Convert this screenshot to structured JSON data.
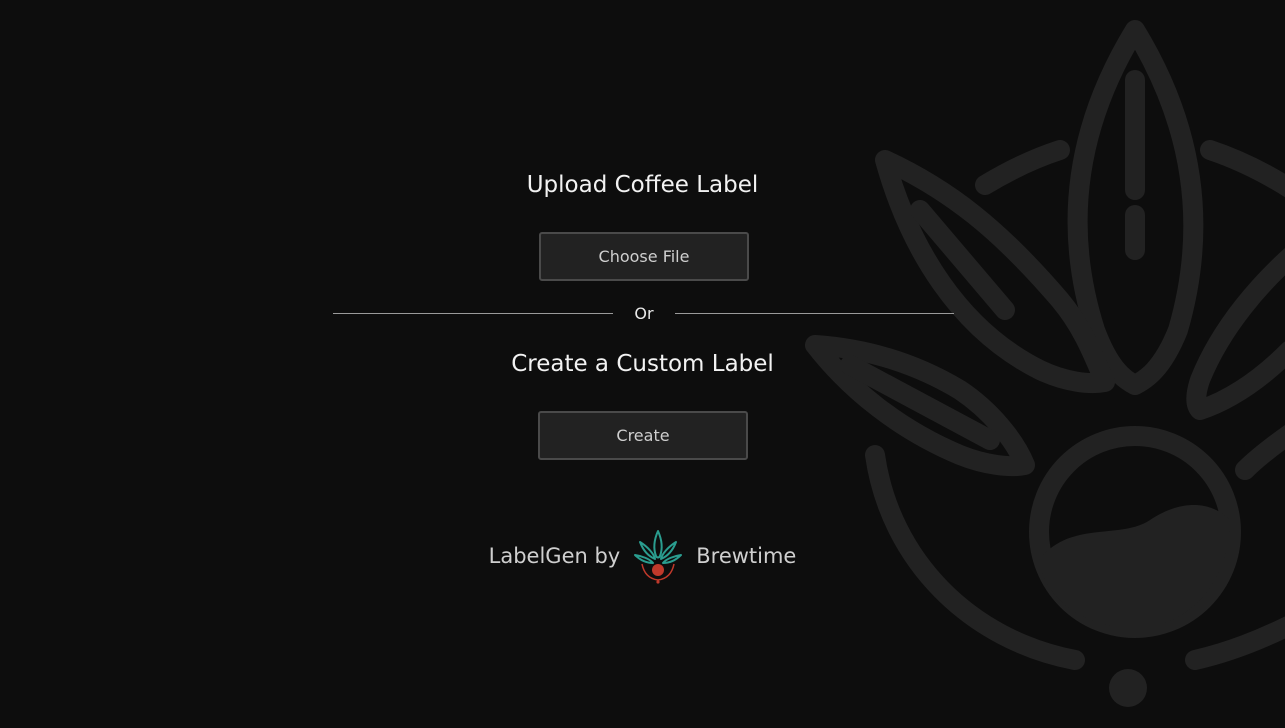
{
  "upload": {
    "title": "Upload Coffee Label",
    "choose_file_label": "Choose File"
  },
  "divider": {
    "text": "Or"
  },
  "custom": {
    "title": "Create a Custom Label",
    "create_label": "Create"
  },
  "footer": {
    "prefix": "LabelGen by",
    "brand": "Brewtime",
    "logo_icon": "brewtime-leaf-logo-icon"
  },
  "colors": {
    "background": "#0d0d0d",
    "button_bg": "#222222",
    "button_border": "#4a4a4a",
    "logo_teal": "#2a9d8f",
    "logo_red": "#c0392b"
  }
}
